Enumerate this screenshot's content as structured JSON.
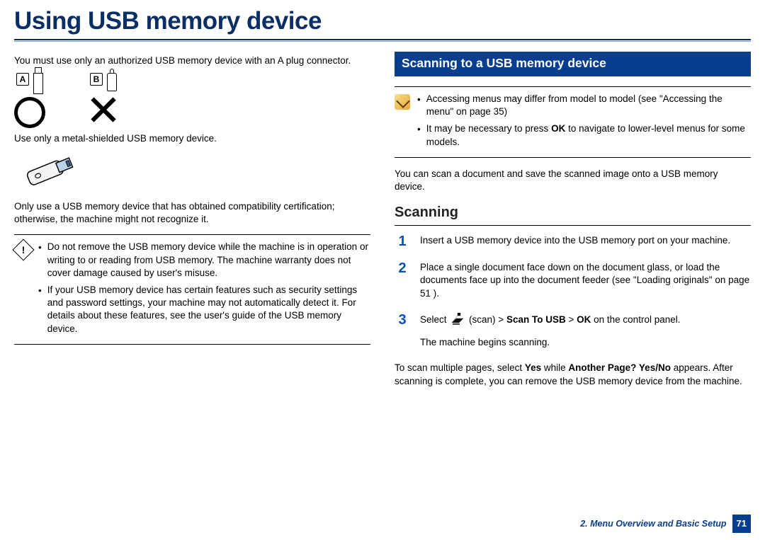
{
  "title": "Using USB memory device",
  "left": {
    "intro": "You must use only an authorized USB memory device with an A plug  connector.",
    "labelA": "A",
    "labelB": "B",
    "metal_text": "Use only a metal-shielded USB memory device.",
    "compat_text": "Only use a USB memory device that has obtained compatibility certification; otherwise, the machine might not recognize it.",
    "warnings": [
      "Do not remove the USB memory device while the machine is in operation or writing to or reading from USB memory. The machine warranty does not cover damage caused by user's misuse.",
      "If your USB memory device has certain features such as security settings and password settings, your machine may not automatically detect it. For details about these features, see the user's guide of the USB memory device."
    ]
  },
  "right": {
    "section_title": "Scanning to a USB memory device",
    "notes": [
      "Accessing menus may differ from model to model (see \"Accessing the menu\" on page 35)",
      "It may be necessary to press OK to navigate to lower-level menus for some models."
    ],
    "note2_prefix": "It may be necessary to press ",
    "note2_bold": "OK",
    "note2_suffix": " to navigate to lower-level menus for some models.",
    "scan_intro": "You can scan a document and save the scanned image onto a USB memory device.",
    "sub_heading": "Scanning",
    "steps": {
      "s1": {
        "num": "1",
        "text": "Insert a USB memory device into the USB memory port on your machine."
      },
      "s2": {
        "num": "2",
        "text": "Place a single document face down on the document glass, or load the documents face up into the document feeder (see \"Loading originals\" on page 51 )."
      },
      "s3": {
        "num": "3",
        "pre": "Select ",
        "after_icon": "(scan) > ",
        "b1": "Scan To USB",
        "mid": " > ",
        "b2": "OK",
        "post": " on the control panel.",
        "line2": "The machine begins scanning."
      }
    },
    "tail_pre": "To scan multiple pages, select ",
    "tail_b1": "Yes",
    "tail_mid": " while ",
    "tail_b2": "Another Page? Yes/No",
    "tail_post": " appears.  After scanning is complete, you can remove the USB memory device from the machine."
  },
  "footer": {
    "chapter": "2. Menu Overview and Basic Setup",
    "page": "71"
  }
}
